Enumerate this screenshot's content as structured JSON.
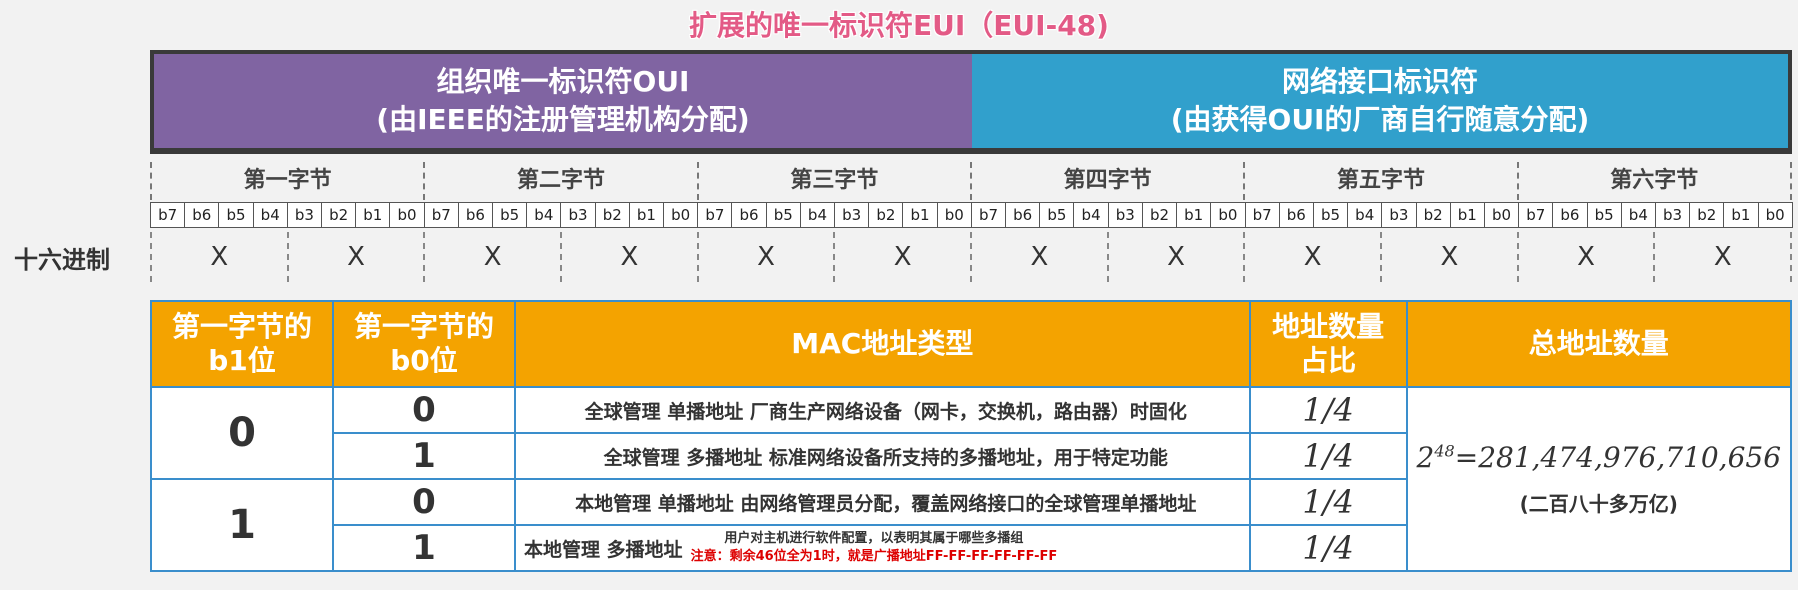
{
  "title": "扩展的唯一标识符EUI（EUI-48)",
  "oui": {
    "line1": "组织唯一标识符OUI",
    "line2": "(由IEEE的注册管理机构分配)"
  },
  "nic": {
    "line1": "网络接口标识符",
    "line2": "(由获得OUI的厂商自行随意分配)"
  },
  "bytes": [
    "第一字节",
    "第二字节",
    "第三字节",
    "第四字节",
    "第五字节",
    "第六字节"
  ],
  "bits": [
    "b7",
    "b6",
    "b5",
    "b4",
    "b3",
    "b2",
    "b1",
    "b0"
  ],
  "hex_label": "十六进制",
  "hex_value": "X",
  "table": {
    "headers": [
      "第一字节的\nb1位",
      "第一字节的\nb0位",
      "MAC地址类型",
      "地址数量\n占比",
      "总地址数量"
    ],
    "b1_values": [
      "0",
      "1"
    ],
    "rows": [
      {
        "b0": "0",
        "desc": "全球管理 单播地址 厂商生产网络设备（网卡，交换机，路由器）时固化",
        "ratio": "1/4"
      },
      {
        "b0": "1",
        "desc": "全球管理 多播地址 标准网络设备所支持的多播地址，用于特定功能",
        "ratio": "1/4"
      },
      {
        "b0": "0",
        "desc": "本地管理 单播地址 由网络管理员分配，覆盖网络接口的全球管理单播地址",
        "ratio": "1/4"
      },
      {
        "b0": "1",
        "desc": "本地管理 多播地址",
        "note": "用户对主机进行软件配置，以表明其属于哪些多播组",
        "warn": "注意：剩余46位全为1时，就是广播地址FF-FF-FF-FF-FF-FF",
        "ratio": "1/4"
      }
    ],
    "total": {
      "base": "2",
      "exp": "48",
      "rest": "=281,474,976,710,656",
      "note": "(二百八十多万亿)"
    }
  }
}
